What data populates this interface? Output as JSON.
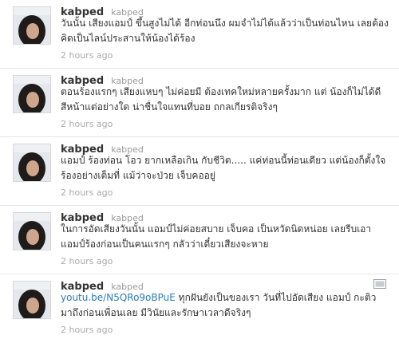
{
  "tweets": [
    {
      "screen_name": "kabped",
      "full_name": "kabped",
      "text": "วันนั้น เสียงแอมป์ ขึ้นสูงไม่ได้ อีกท่อนนึง ผมจำไม่ได้แล้วว่าเป็นท่อนไหน เลยต้องคิดเป็นไลน์ประสานให้น้องได้ร้อง",
      "time": "2 hours ago"
    },
    {
      "screen_name": "kabped",
      "full_name": "kabped",
      "text": "ตอนร้องแรกๆ เสียงแหบๆ ไม่ค่อยมี ต้องเทคใหม่หลายครั้งมาก แต่ น้องก็ไม่ได้ดีสีหน้าแต่อย่างใด น่าชื่นใจแทนที่บอย ถกลเกียรติจริงๆ",
      "time": "2 hours ago"
    },
    {
      "screen_name": "kabped",
      "full_name": "kabped",
      "text": "แอมป์ ร้องท่อน โอว ยากเหลือเกิน กับชีวิต..... แค่ท่อนนี้ท่อนเดียว แต่น้องก็ตั้งใจร้องอย่างเต็มที่ แม้ว่าจะป่วย เจ็บคออยู่",
      "time": "2 hours ago"
    },
    {
      "screen_name": "kabped",
      "full_name": "kabped",
      "text": "ในการอัดเสียงวันนั้น แอมป์ไม่ค่อยสบาย เจ็บคอ เป็นหวัดนิดหน่อย เลยรีบเอาแอมป์ร้องก่อนเป็นคนแรกๆ กลัวว่าเดี๋ยวเสียงจะหาย",
      "time": "2 hours ago"
    },
    {
      "screen_name": "kabped",
      "full_name": "kabped",
      "link": "youtu.be/N5QRo9oBPuE",
      "text": " ทุกฝันยังเป็นของเรา วันที่ไปอัดเสียง แอมป์ กะติว มาถึงก่อนเพื่อนเลย มีวินัยและรักษาเวลาดีจริงๆ",
      "time": "2 hours ago",
      "media_icon": "video-media-icon"
    }
  ]
}
